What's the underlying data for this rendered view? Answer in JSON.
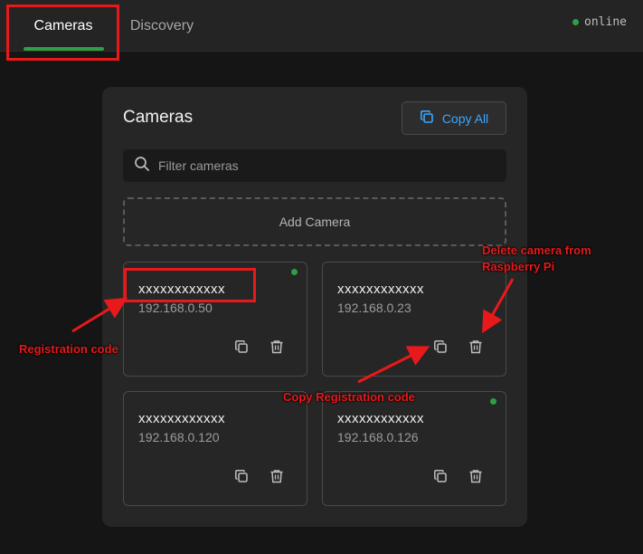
{
  "header": {
    "tabs": [
      {
        "label": "Cameras",
        "active": true
      },
      {
        "label": "Discovery",
        "active": false
      }
    ],
    "status": {
      "label": "online",
      "color": "#2ea043"
    }
  },
  "panel": {
    "title": "Cameras",
    "copy_all_label": "Copy All",
    "search_placeholder": "Filter cameras",
    "add_camera_label": "Add Camera",
    "cameras": [
      {
        "code": "xxxxxxxxxxxx",
        "ip": "192.168.0.50",
        "online": true
      },
      {
        "code": "xxxxxxxxxxxx",
        "ip": "192.168.0.23",
        "online": false
      },
      {
        "code": "xxxxxxxxxxxx",
        "ip": "192.168.0.120",
        "online": false
      },
      {
        "code": "xxxxxxxxxxxx",
        "ip": "192.168.0.126",
        "online": true
      }
    ]
  },
  "annotations": {
    "registration_code": "Registration code",
    "delete_camera_line1": "Delete camera from",
    "delete_camera_line2": "Raspberry Pi",
    "copy_registration_code": "Copy Registration code"
  },
  "colors": {
    "accent_green": "#2ea043",
    "accent_blue": "#3aa6ff",
    "annotation_red": "#e8191b"
  },
  "icons": [
    "search-icon",
    "copy-icon",
    "trash-icon"
  ]
}
